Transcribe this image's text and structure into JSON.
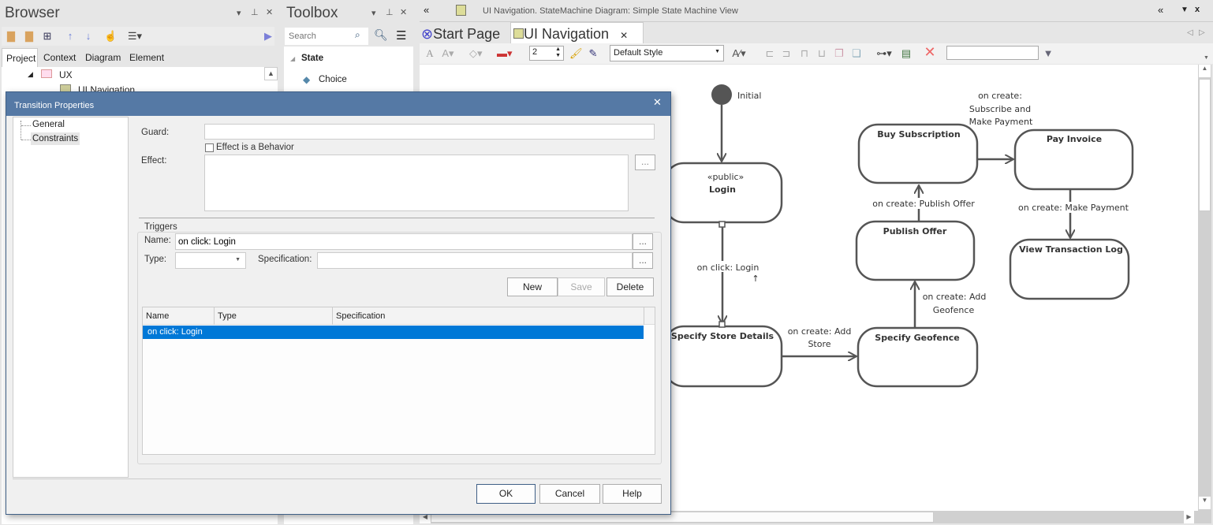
{
  "browser": {
    "title": "Browser",
    "tabs": [
      "Project",
      "Context",
      "Diagram",
      "Element"
    ],
    "active_tab": "Project",
    "tree": [
      {
        "label": "UX",
        "icon": "package-icon"
      },
      {
        "label": "UI Navigation",
        "icon": "diagram-icon"
      }
    ]
  },
  "toolbox": {
    "title": "Toolbox",
    "search_placeholder": "Search",
    "section": "State",
    "items": [
      {
        "label": "Choice",
        "icon": "choice-diamond-icon"
      }
    ]
  },
  "diagram_window": {
    "title": "UI Navigation.  StateMachine Diagram: Simple State Machine View",
    "tabs": [
      {
        "label": "Start Page",
        "icon": "start-page-icon"
      },
      {
        "label": "UI Navigation",
        "icon": "diagram-icon",
        "active": true
      }
    ],
    "toolbar": {
      "line_width": "2",
      "style": "Default Style",
      "filter_value": ""
    }
  },
  "diagram": {
    "initial": "Initial",
    "states": {
      "login_stereotype": "«public»",
      "login": "Login",
      "specify_store": "Specify Store Details",
      "specify_geofence": "Specify Geofence",
      "publish_offer": "Publish Offer",
      "buy_subscription": "Buy Subscription",
      "pay_invoice": "Pay Invoice",
      "view_log": "View Transaction Log"
    },
    "transitions": {
      "login_to_store": "on click: Login",
      "store_to_geofence": [
        "on create: Add",
        "Store"
      ],
      "geofence_to_offer": [
        "on create: Add",
        "Geofence"
      ],
      "offer_to_subscription": "on create: Publish Offer",
      "subscription_to_invoice": [
        "on create:",
        "Subscribe and",
        "Make Payment"
      ],
      "invoice_to_log": "on create: Make Payment"
    }
  },
  "dialog": {
    "title": "Transition Properties",
    "nav": [
      "General",
      "Constraints"
    ],
    "nav_selected": "Constraints",
    "guard_label": "Guard:",
    "guard_value": "",
    "effect_behavior_label": "Effect is a Behavior",
    "effect_behavior_checked": false,
    "effect_label": "Effect:",
    "effect_value": "",
    "ellipsis": "...",
    "triggers": {
      "legend": "Triggers",
      "name_label": "Name:",
      "name_value": "on click: Login",
      "type_label": "Type:",
      "type_value": "",
      "spec_label": "Specification:",
      "spec_value": "",
      "new": "New",
      "save": "Save",
      "delete": "Delete",
      "columns": [
        "Name",
        "Type",
        "Specification"
      ],
      "rows": [
        {
          "name": "on click: Login",
          "type": "",
          "spec": ""
        }
      ]
    },
    "ok": "OK",
    "cancel": "Cancel",
    "help": "Help"
  },
  "colors": {
    "dialog_title": "#5579a5",
    "selection": "#0078d7",
    "state_stroke": "#555555"
  }
}
